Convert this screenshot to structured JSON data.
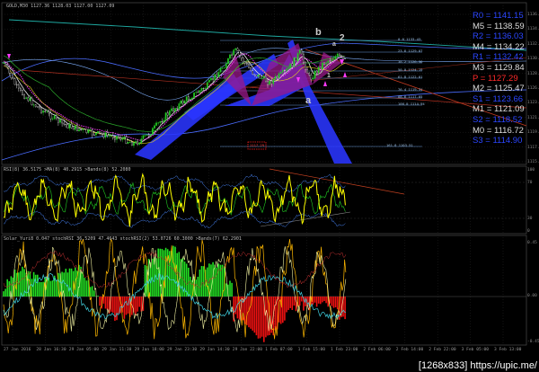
{
  "main_pane": {
    "title": "GOLD,M30  1127.36 1128.03 1127.00 1127.09",
    "price_ticks": [
      "1136.50",
      "1134.40",
      "1132.30",
      "1130.20",
      "1128.10",
      "1126.00",
      "1123.90",
      "1121.80",
      "1119.70",
      "1117.60",
      "1115.50"
    ]
  },
  "levels": [
    {
      "label": "R0 = 1141.15",
      "color": "#2b46ff"
    },
    {
      "label": "M5 = 1138.59",
      "color": "#dddddd"
    },
    {
      "label": "R2 = 1136.03",
      "color": "#2b46ff"
    },
    {
      "label": "M4 = 1134.22",
      "color": "#dddddd"
    },
    {
      "label": "R1 = 1132.42",
      "color": "#2b46ff"
    },
    {
      "label": "M3 = 1129.84",
      "color": "#dddddd"
    },
    {
      "label": "P = 1127.29",
      "color": "#ff2a2a"
    },
    {
      "label": "M2 = 1125.47",
      "color": "#dddddd"
    },
    {
      "label": "S1 = 1123.66",
      "color": "#2b46ff"
    },
    {
      "label": "M1 = 1121.09",
      "color": "#dddddd"
    },
    {
      "label": "S2 = 1118.52",
      "color": "#2b46ff"
    },
    {
      "label": "M0 = 1116.72",
      "color": "#dddddd"
    },
    {
      "label": "S3 = 1114.90",
      "color": "#2b46ff"
    }
  ],
  "fib_labels": [
    "0.0 1133.43",
    "23.6 1129.07",
    "38.2 1126.36",
    "50.0 1124.19",
    "61.8 1122.01",
    "76.4 1119.31",
    "88.6 1117.05",
    "100.0 1114.94",
    "161.8 1103.51"
  ],
  "red_box_label": "1117.29",
  "wave_labels": [
    {
      "text": "b",
      "color": "#3c8cff"
    },
    {
      "text": "2",
      "color": "#f0e000"
    },
    {
      "text": "a",
      "color": "#e8e8e8"
    },
    {
      "text": "1",
      "color": "#f0e000"
    },
    {
      "text": "a",
      "color": "#3c8cff"
    }
  ],
  "rsi_pane": {
    "title": "RSI(8) 36.5175  >MA(8) 40.2915  >Bands(8) 52.2080",
    "ticks": [
      "100",
      "70",
      "30",
      "0"
    ]
  },
  "macd_pane": {
    "title": "Solar_Yuri8  0.047  stochRSI 36.5209 47.4643  stochRSI(2) 53.0726 60.3000  >Bands(7) 62.2901",
    "ticks": [
      "0.45",
      "0.00",
      "-0.45"
    ]
  },
  "time_labels": [
    "27 Jan 2016",
    "28 Jan 16:30",
    "29 Jan 05:00",
    "29 Jan 11:30",
    "29 Jan 18:00",
    "29 Jan 23:30",
    "29 Jan 14:30",
    "29 Jan 22:00",
    "1 Feb 07:00",
    "1 Feb 15:00",
    "1 Feb 23:00",
    "2 Feb 06:00",
    "2 Feb 14:00",
    "2 Feb 22:00",
    "3 Feb 05:00",
    "3 Feb 13:00"
  ],
  "watermark": "[1268x833] https://upic.me/",
  "colors": {
    "background": "#000000",
    "grid": "#2a2a2a",
    "candle_up": "#22cc22",
    "candle_down": "#ffffff",
    "wedge": "#2a35ff",
    "pattern_fill": "#9a1a8a",
    "rsi_line": "#ffff00",
    "hist_pos": "#22dd22",
    "hist_neg": "#ee1111"
  }
}
